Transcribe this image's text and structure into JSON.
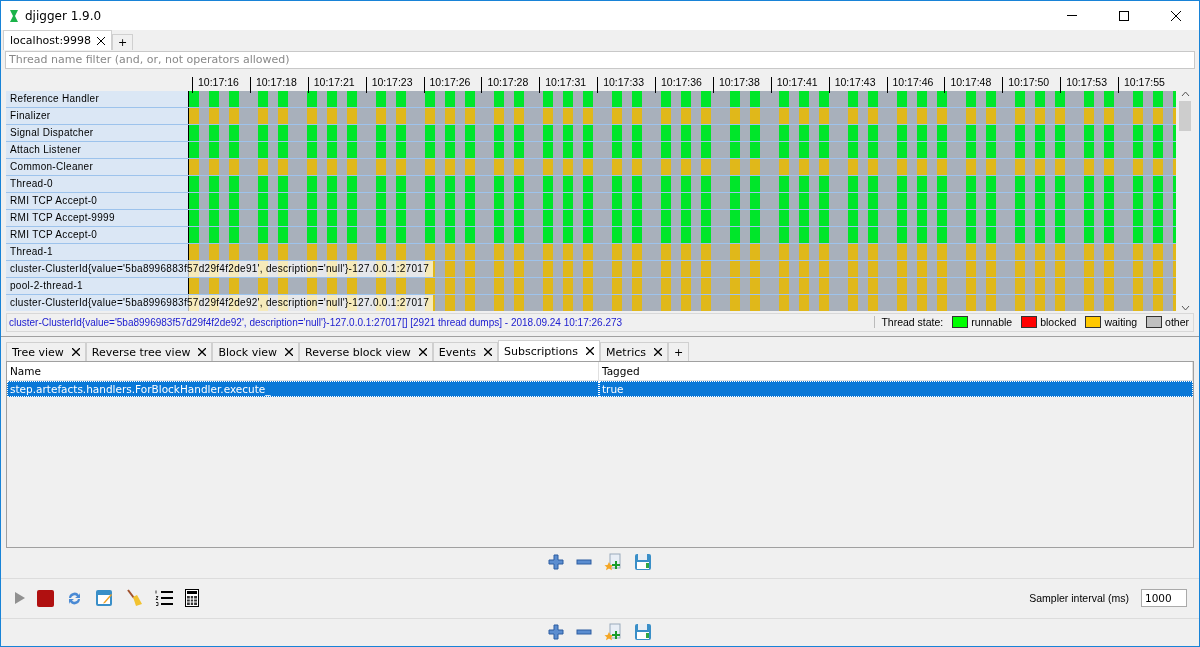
{
  "window": {
    "title": "djigger 1.9.0"
  },
  "connection_tabs": [
    {
      "label": "localhost:9998",
      "selected": true
    }
  ],
  "add_tab": "+",
  "filter": {
    "placeholder": "Thread name filter (and, or, not operators allowed)"
  },
  "time_axis": [
    "10:17:16",
    "10:17:18",
    "10:17:21",
    "10:17:23",
    "10:17:26",
    "10:17:28",
    "10:17:31",
    "10:17:33",
    "10:17:36",
    "10:17:38",
    "10:17:41",
    "10:17:43",
    "10:17:46",
    "10:17:48",
    "10:17:50",
    "10:17:53",
    "10:17:55"
  ],
  "threads": [
    {
      "name": "Reference Handler",
      "kind": "runnable"
    },
    {
      "name": "Finalizer",
      "kind": "waiting"
    },
    {
      "name": "Signal Dispatcher",
      "kind": "runnable"
    },
    {
      "name": "Attach Listener",
      "kind": "runnable"
    },
    {
      "name": "Common-Cleaner",
      "kind": "waiting"
    },
    {
      "name": "Thread-0",
      "kind": "runnable"
    },
    {
      "name": "RMI TCP Accept-0",
      "kind": "runnable"
    },
    {
      "name": "RMI TCP Accept-9999",
      "kind": "runnable"
    },
    {
      "name": "RMI TCP Accept-0",
      "kind": "runnable"
    },
    {
      "name": "Thread-1",
      "kind": "waiting"
    },
    {
      "name": "cluster-ClusterId{value='5ba8996883f57d29f4f2de91', description='null'}-127.0.0.1:27017",
      "kind": "waiting"
    },
    {
      "name": "pool-2-thread-1",
      "kind": "waiting"
    },
    {
      "name": "cluster-ClusterId{value='5ba8996983f57d29f4f2de92', description='null'}-127.0.0.1:27017",
      "kind": "waiting"
    }
  ],
  "status": {
    "text": "cluster-ClusterId{value='5ba8996983f57d29f4f2de92', description='null'}-127.0.0.1:27017[] [2921 thread dumps] - 2018.09.24 10:17:26.273",
    "legend_title": "Thread state:",
    "legend": [
      {
        "label": "runnable",
        "color": "#00ff00"
      },
      {
        "label": "blocked",
        "color": "#ff0000"
      },
      {
        "label": "waiting",
        "color": "#ffc800"
      },
      {
        "label": "other",
        "color": "#c0c0c0"
      }
    ]
  },
  "view_tabs": [
    {
      "label": "Tree view",
      "selected": false
    },
    {
      "label": "Reverse tree view",
      "selected": false
    },
    {
      "label": "Block view",
      "selected": false
    },
    {
      "label": "Reverse block view",
      "selected": false
    },
    {
      "label": "Events",
      "selected": false
    },
    {
      "label": "Subscriptions",
      "selected": true
    },
    {
      "label": "Metrics",
      "selected": false
    }
  ],
  "add_view_tab": "+",
  "table": {
    "columns": [
      "Name",
      "Tagged"
    ],
    "rows": [
      {
        "cells": [
          "step.artefacts.handlers.ForBlockHandler.execute_",
          "true"
        ],
        "selected": true
      }
    ]
  },
  "sampler": {
    "label": "Sampler interval (ms)",
    "value": "1000"
  }
}
